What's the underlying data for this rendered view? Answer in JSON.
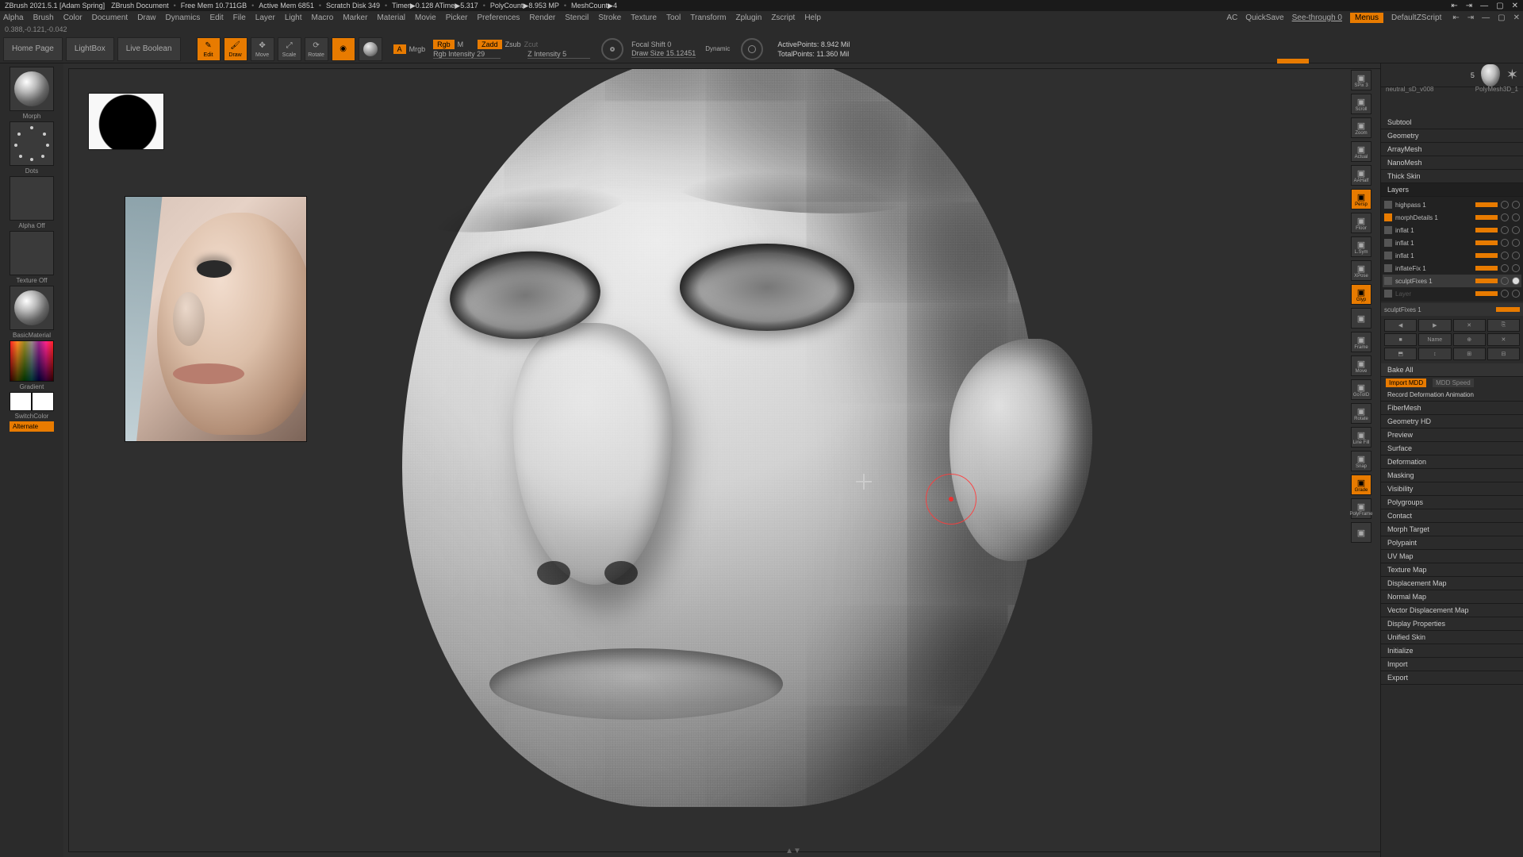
{
  "titlebar": {
    "app": "ZBrush 2021.5.1 [Adam Spring]",
    "doc": "ZBrush Document",
    "freemem": "Free Mem 10.711GB",
    "activemem": "Active Mem 6851",
    "scratch": "Scratch Disk 349",
    "timer": "Timer▶0.128 ATime▶5.317",
    "polycount": "PolyCount▶8.953 MP",
    "meshcount": "MeshCount▶4",
    "bullet": "•"
  },
  "menu": {
    "items": [
      "Alpha",
      "Brush",
      "Color",
      "Document",
      "Draw",
      "Dynamics",
      "Edit",
      "File",
      "Layer",
      "Light",
      "Macro",
      "Marker",
      "Material",
      "Movie",
      "Picker",
      "Preferences",
      "Render",
      "Stencil",
      "Stroke",
      "Texture",
      "Tool",
      "Transform",
      "Zplugin",
      "Zscript",
      "Help"
    ],
    "right": {
      "ac": "AC",
      "quicksave": "QuickSave",
      "seethrough": "See-through  0",
      "menus": "Menus",
      "default": "DefaultZScript"
    }
  },
  "coords": "0.388,-0.121,-0.042",
  "shelf": {
    "home": "Home Page",
    "lightbox": "LightBox",
    "livebool": "Live Boolean",
    "edit": "Edit",
    "draw": "Draw",
    "move": "Move",
    "scale": "Scale",
    "rotate": "Rotate",
    "a": "A",
    "mrgb": "Mrgb",
    "rgb": "Rgb",
    "m": "M",
    "zadd": "Zadd",
    "zsub": "Zsub",
    "zcut": "Zcut",
    "rgbint": "Rgb Intensity 29",
    "zint": "Z Intensity 5",
    "focal": "Focal Shift 0",
    "drawsize": "Draw Size 15.12451",
    "dynamic": "Dynamic",
    "active": "ActivePoints: 8.942 Mil",
    "total": "TotalPoints: 11.360 Mil"
  },
  "leftTray": {
    "morph": "Morph",
    "dots": "Dots",
    "alphaoff": "Alpha Off",
    "textureoff": "Texture Off",
    "basicmat": "BasicMaterial",
    "gradient": "Gradient",
    "switchcolor": "SwitchColor",
    "alternate": "Alternate"
  },
  "dock": {
    "items": [
      {
        "label": "SPix 3",
        "orange": false
      },
      {
        "label": "Scroll",
        "orange": false
      },
      {
        "label": "Zoom",
        "orange": false
      },
      {
        "label": "Actual",
        "orange": false
      },
      {
        "label": "AAHalf",
        "orange": false
      },
      {
        "label": "Persp",
        "orange": true
      },
      {
        "label": "Floor",
        "orange": false
      },
      {
        "label": "L.Sym",
        "orange": false
      },
      {
        "label": "XPose",
        "orange": false
      },
      {
        "label": "Glyp",
        "orange": true
      },
      {
        "label": "",
        "orange": false
      },
      {
        "label": "Frame",
        "orange": false
      },
      {
        "label": "Move",
        "orange": false
      },
      {
        "label": "GoToID",
        "orange": false
      },
      {
        "label": "Rotate",
        "orange": false
      },
      {
        "label": "Line Fill",
        "orange": false
      },
      {
        "label": "Snap",
        "orange": false
      },
      {
        "label": "Grade",
        "orange": true
      },
      {
        "label": "PolyFrame",
        "orange": false
      },
      {
        "label": "",
        "orange": false
      }
    ]
  },
  "rp": {
    "tool1": "neutral_sD_v008",
    "tool2": "PolyMesh3D_1",
    "slot": "5",
    "sections1": [
      "Subtool",
      "Geometry",
      "ArrayMesh",
      "NanoMesh",
      "Thick Skin"
    ],
    "layersTitle": "Layers",
    "layers": [
      {
        "name": "highpass 1",
        "on": false
      },
      {
        "name": "morphDetails 1",
        "on": true
      },
      {
        "name": "inflat 1",
        "on": false
      },
      {
        "name": "inflat 1",
        "on": false
      },
      {
        "name": "inflat 1",
        "on": false
      },
      {
        "name": "inflateFix 1",
        "on": false
      },
      {
        "name": "sculptFixes 1",
        "on": false,
        "sel": true
      },
      {
        "name": "Layer",
        "on": false,
        "dim": true
      }
    ],
    "layerName": "sculptFixes 1",
    "layerBtns": [
      "◀",
      "▶",
      "✕",
      "⎘",
      "■",
      "Name",
      "⊕",
      "✕",
      "⬒",
      "↕",
      "⊞",
      "⊟"
    ],
    "bakeAll": "Bake All",
    "importMDD": "Import MDD",
    "mddSpeed": "MDD Speed",
    "recordDeform": "Record Deformation Animation",
    "sections2": [
      "FiberMesh",
      "Geometry HD",
      "Preview",
      "Surface",
      "Deformation",
      "Masking",
      "Visibility",
      "Polygroups",
      "Contact",
      "Morph Target",
      "Polypaint",
      "UV Map",
      "Texture Map",
      "Displacement Map",
      "Normal Map",
      "Vector Displacement Map",
      "Display Properties",
      "Unified Skin",
      "Initialize",
      "Import",
      "Export"
    ]
  }
}
